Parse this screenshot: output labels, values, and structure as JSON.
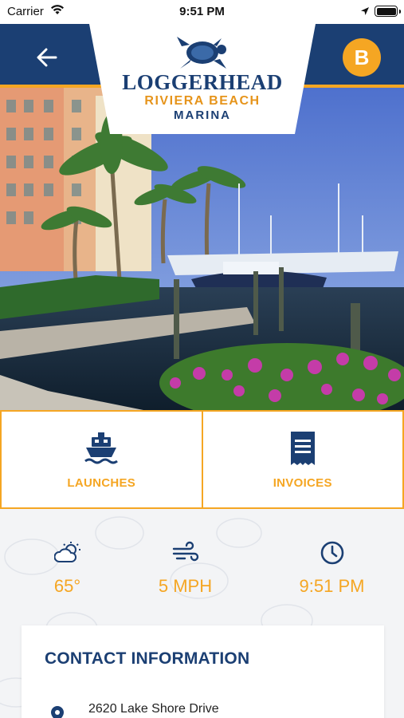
{
  "status_bar": {
    "carrier": "Carrier",
    "time": "9:51 PM"
  },
  "header": {
    "logo_main": "LOGGERHEAD",
    "logo_sub1": "RIVIERA BEACH",
    "logo_sub2": "MARINA",
    "profile_initial": "B"
  },
  "actions": [
    {
      "label": "LAUNCHES",
      "icon": "boat-icon"
    },
    {
      "label": "INVOICES",
      "icon": "receipt-icon"
    }
  ],
  "weather": {
    "temperature": "65°",
    "wind": "5 MPH",
    "time": "9:51 PM"
  },
  "contact": {
    "title": "CONTACT INFORMATION",
    "address_line1": "2620 Lake Shore Drive"
  },
  "colors": {
    "navy": "#1b3f73",
    "accent": "#f5a623"
  }
}
